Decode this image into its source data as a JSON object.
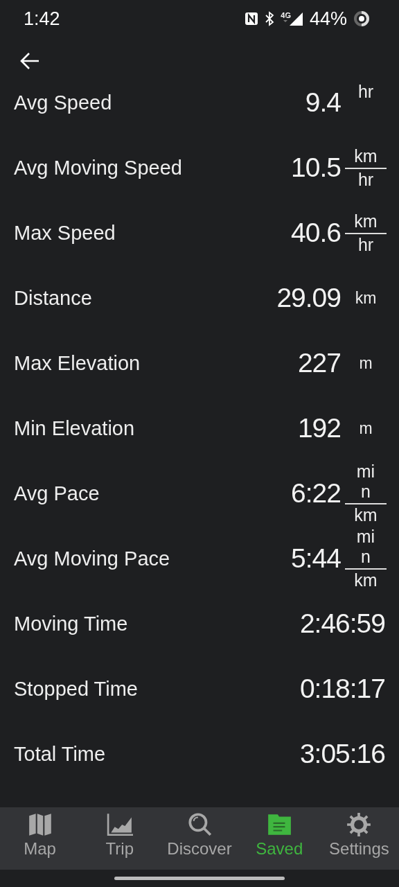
{
  "status_bar": {
    "time": "1:42",
    "network": "4G",
    "battery": "44%"
  },
  "stats": [
    {
      "label": "Avg Speed",
      "value": "9.4",
      "unit": {
        "kind": "fraction",
        "denominator": "hr"
      }
    },
    {
      "label": "Avg Moving Speed",
      "value": "10.5",
      "unit": {
        "kind": "fraction",
        "numerator": "km",
        "denominator": "hr"
      }
    },
    {
      "label": "Max Speed",
      "value": "40.6",
      "unit": {
        "kind": "fraction",
        "numerator": "km",
        "denominator": "hr"
      }
    },
    {
      "label": "Distance",
      "value": "29.09",
      "unit": {
        "kind": "plain",
        "text": "km"
      }
    },
    {
      "label": "Max Elevation",
      "value": "227",
      "unit": {
        "kind": "plain",
        "text": "m"
      }
    },
    {
      "label": "Min Elevation",
      "value": "192",
      "unit": {
        "kind": "plain",
        "text": "m"
      }
    },
    {
      "label": "Avg Pace",
      "value": "6:22",
      "unit": {
        "kind": "fraction",
        "numerator": "min",
        "denominator": "km"
      }
    },
    {
      "label": "Avg Moving Pace",
      "value": "5:44",
      "unit": {
        "kind": "fraction",
        "numerator": "min",
        "denominator": "km"
      }
    },
    {
      "label": "Moving Time",
      "value": "2:46:59",
      "unit": {
        "kind": "none"
      }
    },
    {
      "label": "Stopped Time",
      "value": "0:18:17",
      "unit": {
        "kind": "none"
      }
    },
    {
      "label": "Total Time",
      "value": "3:05:16",
      "unit": {
        "kind": "none"
      }
    }
  ],
  "nav": [
    {
      "label": "Map",
      "selected": false
    },
    {
      "label": "Trip",
      "selected": false
    },
    {
      "label": "Discover",
      "selected": false
    },
    {
      "label": "Saved",
      "selected": true
    },
    {
      "label": "Settings",
      "selected": false
    }
  ]
}
